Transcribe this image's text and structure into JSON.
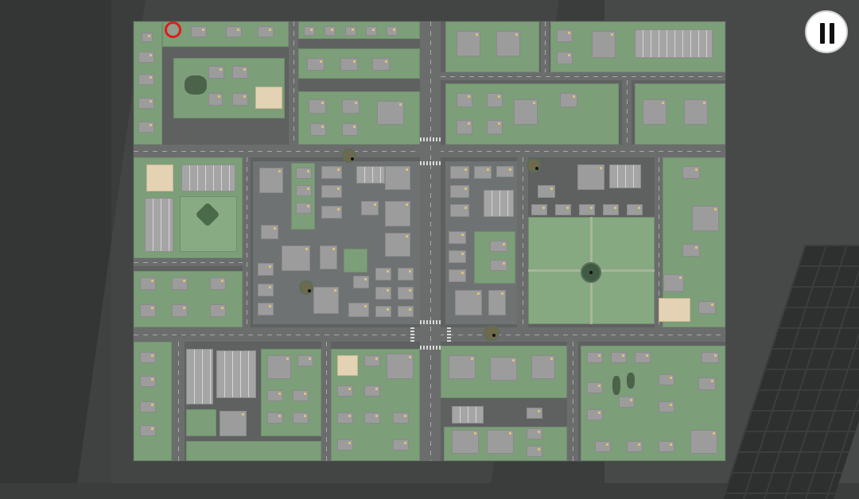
{
  "game": {
    "view": "city-map",
    "controls": {
      "pause_icon": "pause-icon"
    },
    "player_marker": {
      "icon": "player-location-ring",
      "color": "#e01b1b"
    },
    "colors": {
      "background": "#3b3d3d",
      "road": "#6b6d6d",
      "grass_block": "#7c9e79",
      "building_roof": "#9c9c9c",
      "sand_lot": "#e3d3b4",
      "roundabout": "#3f5b43"
    }
  }
}
